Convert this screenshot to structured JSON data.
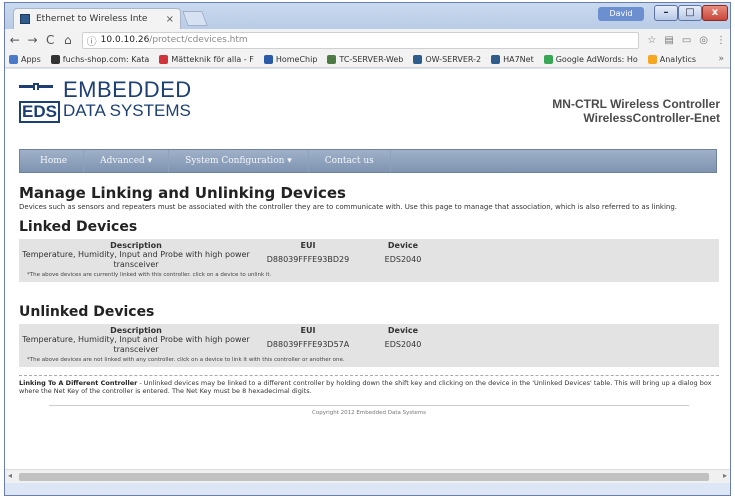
{
  "browser": {
    "tab_title": "Ethernet to Wireless Inte",
    "tab_close": "×",
    "user_badge": "David",
    "win_min": "–",
    "win_max": "□",
    "win_close": "x",
    "nav_back": "←",
    "nav_forward": "→",
    "nav_reload": "C",
    "nav_home": "⌂",
    "url_host": "10.0.10.26",
    "url_path": "/protect/cdevices.htm",
    "star": "☆",
    "menu": "⋮",
    "bookmarks": [
      {
        "label": "Apps",
        "icon": "apps-icon",
        "color": "#4a7ac9"
      },
      {
        "label": "fuchs-shop.com: Kata",
        "icon": "flag-icon",
        "color": "#333333"
      },
      {
        "label": "Mätteknik för alla - F",
        "icon": "circle-icon",
        "color": "#d0343a"
      },
      {
        "label": "HomeChip",
        "icon": "person-icon",
        "color": "#2a5aa8"
      },
      {
        "label": "TC-SERVER-Web",
        "icon": "server-icon",
        "color": "#4d7a44"
      },
      {
        "label": "OW-SERVER-2",
        "icon": "server-icon",
        "color": "#2f5c8a"
      },
      {
        "label": "HA7Net",
        "icon": "server-icon",
        "color": "#2f5c8a"
      },
      {
        "label": "Google AdWords: Ho",
        "icon": "adwords-icon",
        "color": "#3aa757"
      },
      {
        "label": "Analytics",
        "icon": "analytics-icon",
        "color": "#f5a623"
      }
    ],
    "bookmarks_more": "»"
  },
  "header": {
    "logo_line1": "EMBEDDED",
    "logo_line2": "DATA SYSTEMS",
    "logo_eds": "EDS",
    "device_line1": "MN-CTRL Wireless Controller",
    "device_line2": "WirelessController-Enet"
  },
  "nav": {
    "home": "Home",
    "advanced": "Advanced ▾",
    "system_configuration": "System Configuration ▾",
    "contact_us": "Contact us"
  },
  "page": {
    "title": "Manage Linking and Unlinking Devices",
    "intro": "Devices such as sensors and repeaters must be associated with the controller they are to communicate with. Use this page to manage that association, which is also referred to as linking.",
    "linked_title": "Linked Devices",
    "unlinked_title": "Unlinked Devices",
    "columns": {
      "description": "Description",
      "eui": "EUI",
      "device": "Device"
    },
    "linked_rows": [
      {
        "description": "Temperature, Humidity, Input and Probe with high power transceiver",
        "eui": "D88039FFFE93BD29",
        "device": "EDS2040"
      }
    ],
    "unlinked_rows": [
      {
        "description": "Temperature, Humidity, Input and Probe with high power transceiver",
        "eui": "D88039FFFE93D57A",
        "device": "EDS2040"
      }
    ],
    "linked_note": "*The above devices are currently linked with this controller. click on a device to unlink it.",
    "unlinked_note": "*The above devices are not linked with any controller. click on a device to link it with this controller or another one.",
    "linking_heading": "Linking To A Different Controller",
    "linking_text": " - Unlinked devices may be linked to a different controller by holding down the shift key and clicking on the device in the 'Unlinked Devices' table. This will bring up a dialog box where the Net Key of the controller is entered. The Net Key must be 8 hexadecimal digits.",
    "copyright": "Copyright 2012 Embedded Data Systems"
  }
}
